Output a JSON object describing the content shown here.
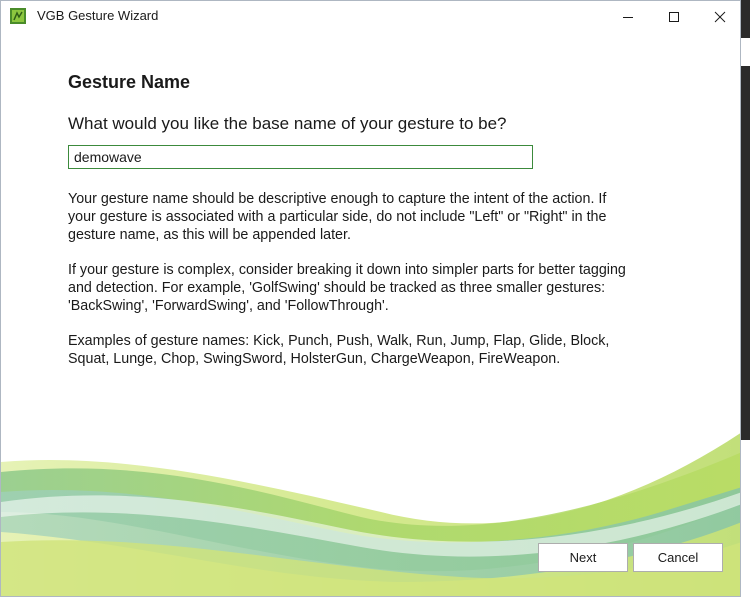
{
  "window": {
    "title": "VGB Gesture Wizard"
  },
  "page": {
    "heading": "Gesture Name",
    "question": "What would you like the base name of your gesture to be?",
    "name_input": {
      "value": "demowave",
      "placeholder": ""
    },
    "paragraphs": [
      "Your gesture name should be descriptive enough to capture the intent of the action. If your gesture is associated with a particular side, do not include \"Left\" or \"Right\" in the gesture name, as this will be appended later.",
      "If your gesture is complex, consider breaking it down into simpler parts for better tagging and detection. For example, 'GolfSwing' should be tracked as three smaller gestures: 'BackSwing', 'ForwardSwing', and 'FollowThrough'.",
      "Examples of gesture names: Kick, Punch, Push, Walk, Run, Jump, Flap, Glide, Block, Squat, Lunge, Chop, SwingSword, HolsterGun, ChargeWeapon, FireWeapon."
    ]
  },
  "buttons": {
    "next": "Next",
    "cancel": "Cancel"
  },
  "icons": {
    "app": "kinect-gesture-app-icon",
    "minimize": "minimize-icon",
    "maximize": "maximize-icon",
    "close": "close-icon"
  },
  "colors": {
    "accent_green": "#3c8a3c",
    "wave_light": "#d8eb9a",
    "wave_mid": "#a9d36b",
    "wave_teal": "#8fc8b4"
  }
}
